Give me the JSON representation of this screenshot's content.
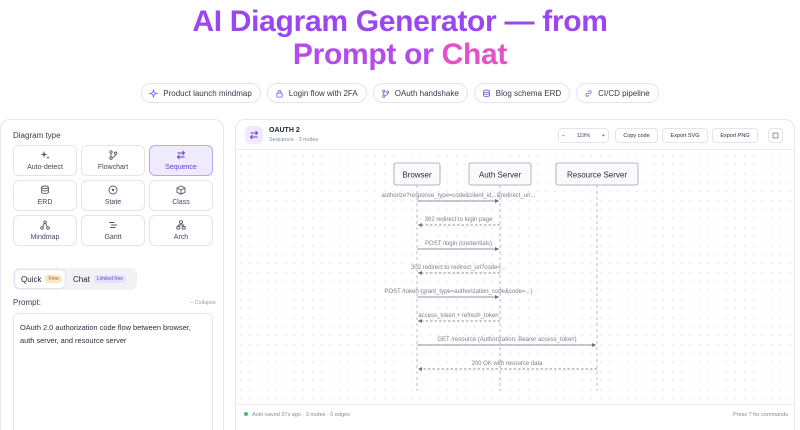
{
  "hero": {
    "line1": "AI Diagram Generator — from",
    "line2a": "Prompt or ",
    "line2b": "Chat"
  },
  "examples": [
    {
      "label": "Product launch mindmap",
      "icon": "sparkle-icon"
    },
    {
      "label": "Login flow with 2FA",
      "icon": "lock-icon"
    },
    {
      "label": "OAuth handshake",
      "icon": "branch-icon"
    },
    {
      "label": "Blog schema ERD",
      "icon": "database-icon"
    },
    {
      "label": "CI/CD pipeline",
      "icon": "link-icon"
    }
  ],
  "left": {
    "diagram_type_label": "Diagram type",
    "types": [
      {
        "label": "Auto-detect",
        "icon": "sparkle-icon"
      },
      {
        "label": "Flowchart",
        "icon": "branch-icon"
      },
      {
        "label": "Sequence",
        "icon": "swap-arrows-icon",
        "selected": true
      },
      {
        "label": "ERD",
        "icon": "database-icon"
      },
      {
        "label": "State",
        "icon": "state-circle-icon"
      },
      {
        "label": "Class",
        "icon": "cube-icon"
      },
      {
        "label": "Mindmap",
        "icon": "mindmap-icon"
      },
      {
        "label": "Gantt",
        "icon": "gantt-icon"
      },
      {
        "label": "Arch",
        "icon": "arch-icon"
      }
    ],
    "mode_quick": "Quick",
    "mode_quick_badge": "Free",
    "mode_chat": "Chat",
    "mode_chat_badge": "Limited free",
    "prompt_label": "Prompt:",
    "collapse": "– Collapse",
    "prompt_value": "OAuth 2.0 authorization code flow between browser, auth server, and resource server"
  },
  "editor": {
    "title": "OAUTH 2",
    "subtitle": "Sequence · 3 nodes",
    "zoom_minus": "–",
    "zoom": "119%",
    "zoom_plus": "+",
    "copy_code": "Copy code",
    "export_svg": "Export SVG",
    "export_png": "Export PNG",
    "footer_status": "Auto-saved 27s ago · 3 nodes · 0 edges",
    "footer_hint": "Press ? for commands"
  },
  "sequence": {
    "participants": [
      "Browser",
      "Auth Server",
      "Resource Server"
    ],
    "messages": [
      {
        "from": 0,
        "to": 1,
        "text": "authorize?response_type=code&client_id...&redirect_uri...",
        "dashed": false
      },
      {
        "from": 1,
        "to": 0,
        "text": "302 redirect to login page",
        "dashed": true
      },
      {
        "from": 0,
        "to": 1,
        "text": "POST /login (credentials)",
        "dashed": false
      },
      {
        "from": 1,
        "to": 0,
        "text": "302 redirect to redirect_uri?code=...",
        "dashed": true
      },
      {
        "from": 0,
        "to": 1,
        "text": "POST /token (grant_type=authorization_code&code=...)",
        "dashed": false
      },
      {
        "from": 1,
        "to": 0,
        "text": "access_token + refresh_token",
        "dashed": true
      },
      {
        "from": 0,
        "to": 2,
        "text": "GET /resource (Authorization: Bearer access_token)",
        "dashed": false
      },
      {
        "from": 2,
        "to": 0,
        "text": "200 OK with resource data",
        "dashed": true
      }
    ]
  },
  "colors": {
    "accent": "#7c5ce0",
    "selected_bg": "#efeafd",
    "hero_start": "#9a47f2",
    "hero_end": "#e451c8"
  }
}
